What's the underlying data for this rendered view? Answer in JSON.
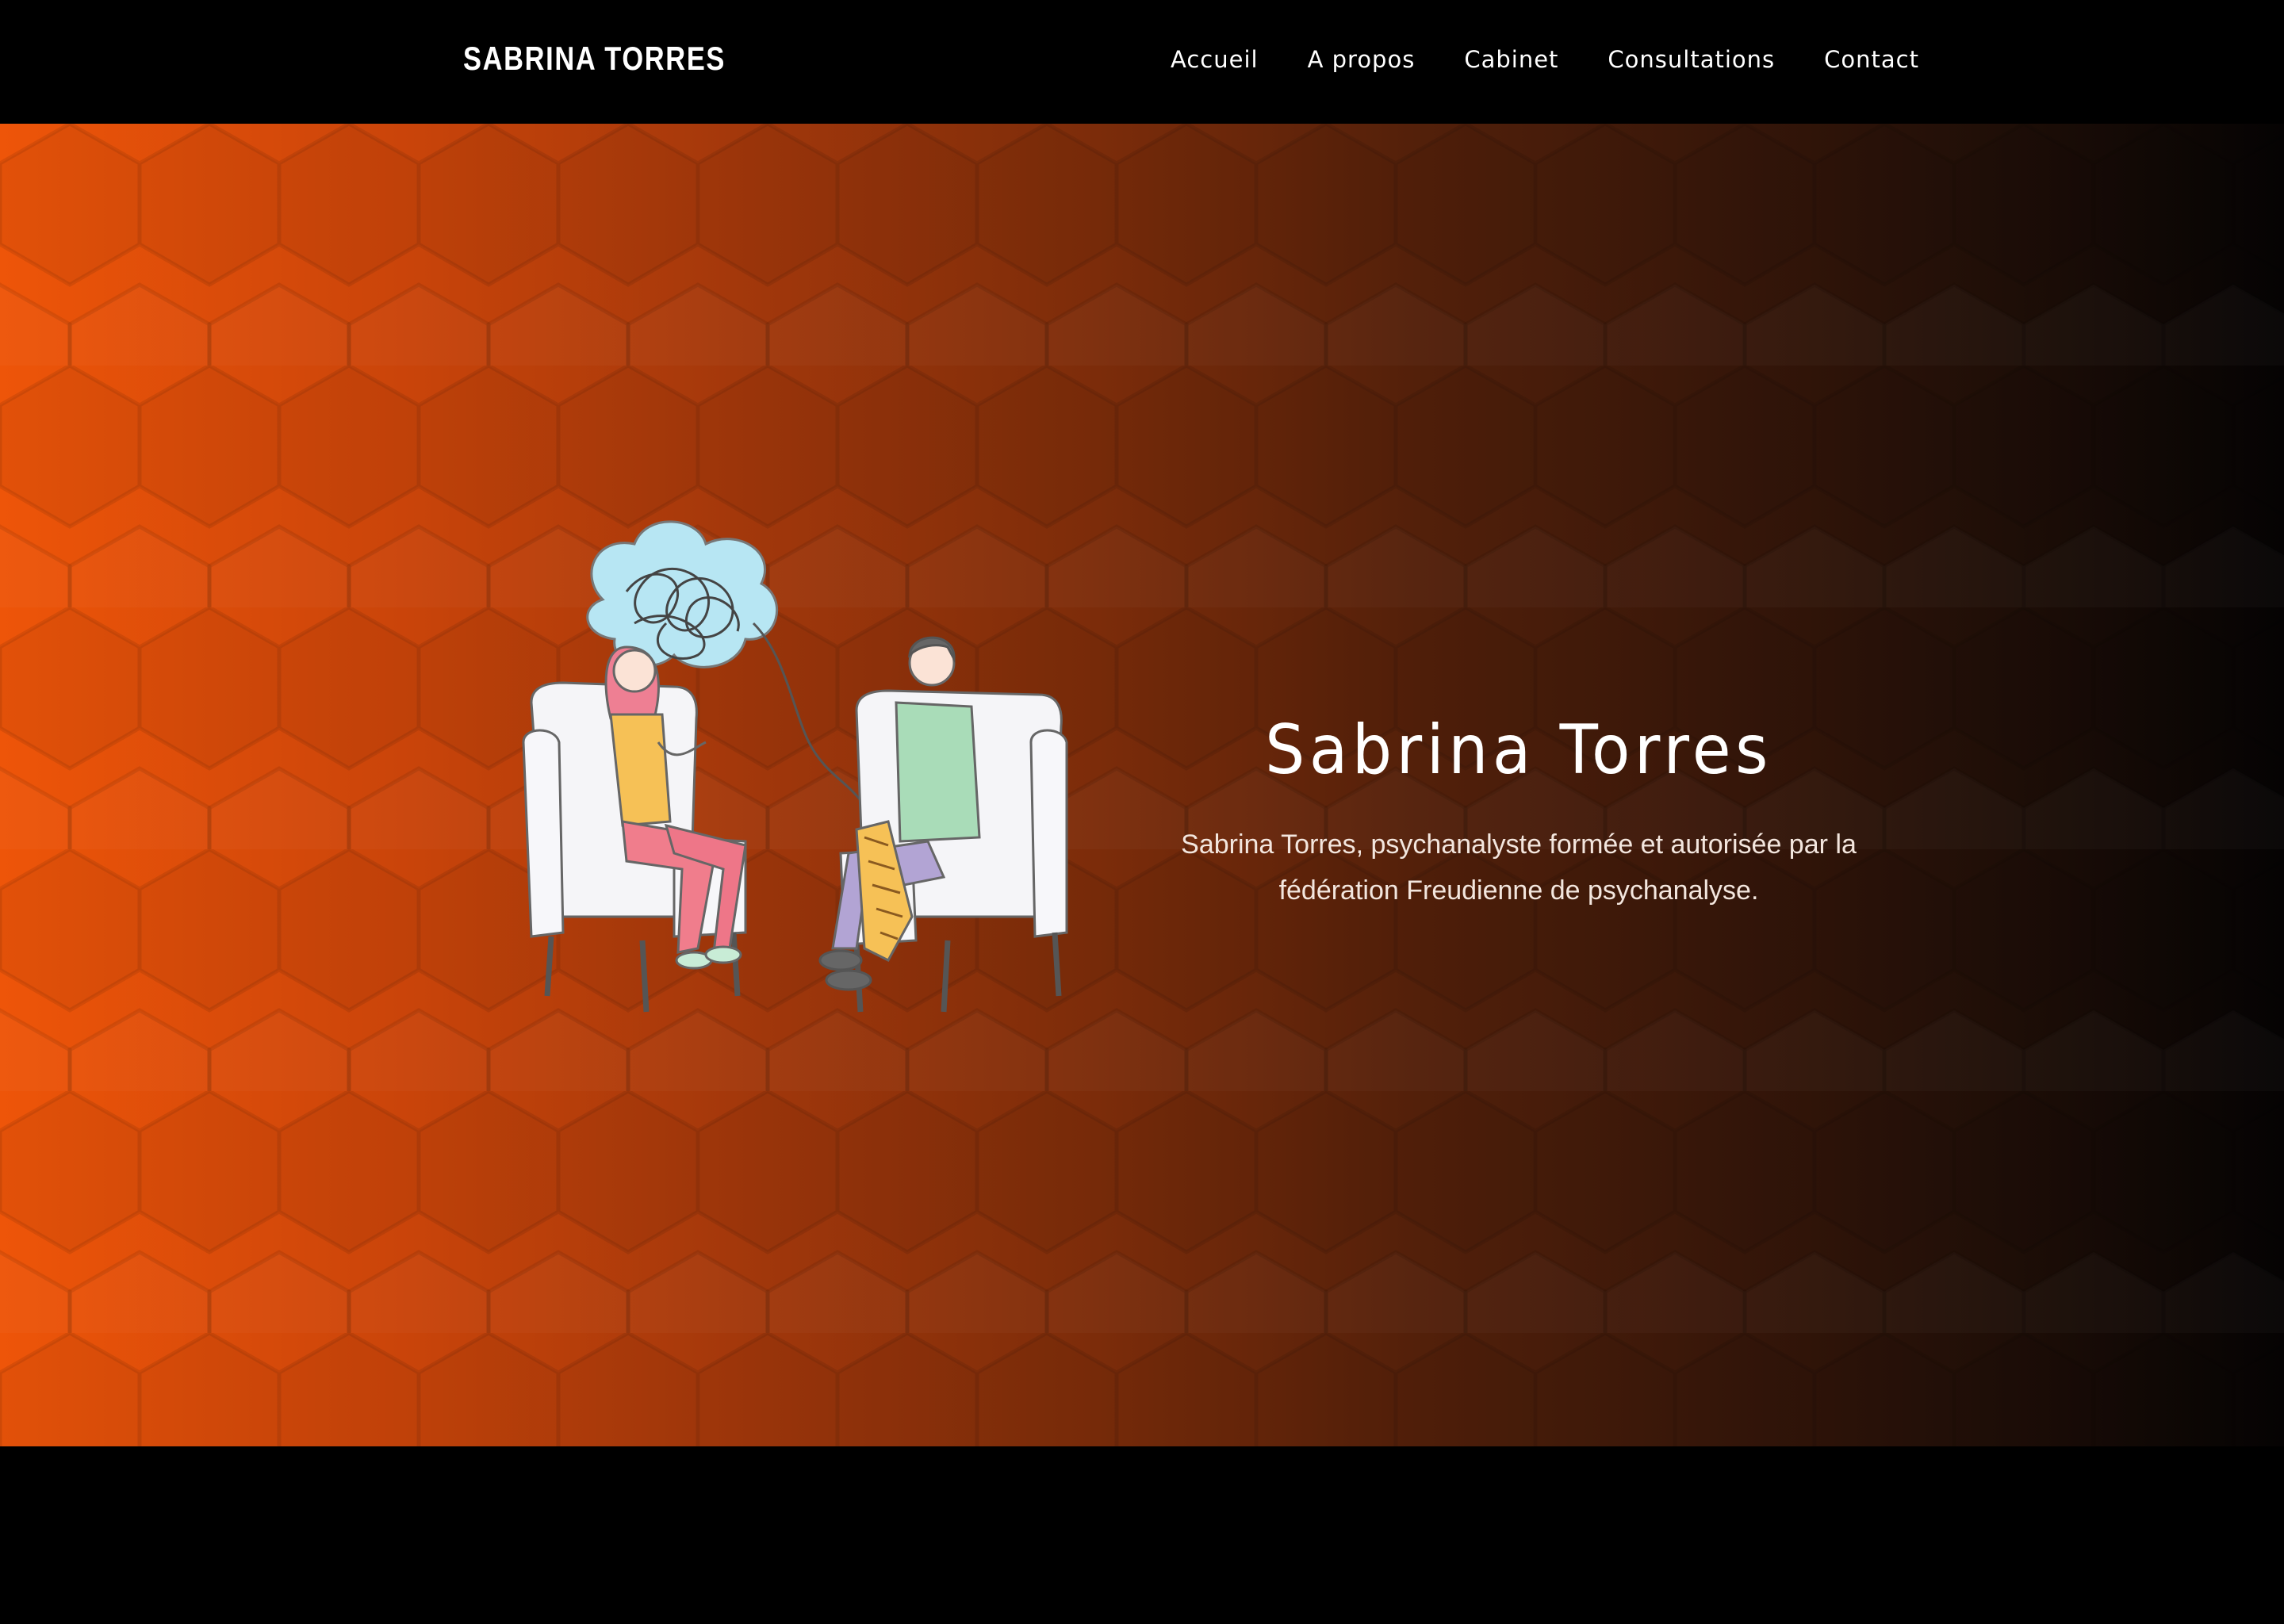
{
  "header": {
    "brand": "SABRINA TORRES",
    "nav": [
      {
        "label": "Accueil"
      },
      {
        "label": "A propos"
      },
      {
        "label": "Cabinet"
      },
      {
        "label": "Consultations"
      },
      {
        "label": "Contact"
      }
    ]
  },
  "hero": {
    "title": "Sabrina Torres",
    "description": "Sabrina Torres, psychanalyste formée et autorisée par la fédération Freudienne de psychanalyse.",
    "gradient_start": "#ee5509",
    "gradient_end": "#050303",
    "illustration_icon": "therapy-session-illustration"
  }
}
